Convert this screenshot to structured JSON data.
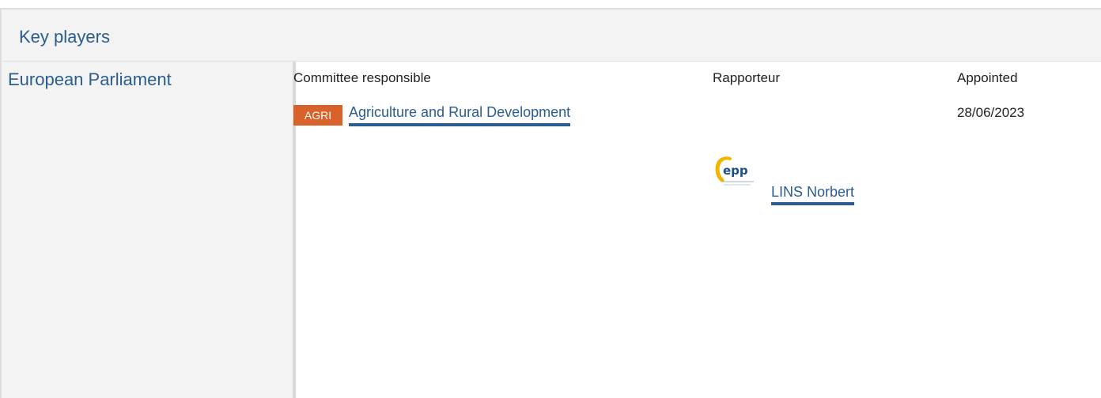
{
  "section": {
    "title": "Key players"
  },
  "institution": {
    "name": "European Parliament"
  },
  "columns": {
    "committee": "Committee responsible",
    "rapporteur": "Rapporteur",
    "appointed": "Appointed"
  },
  "committee": {
    "code": "AGRI",
    "name": "Agriculture and Rural Development",
    "badge_color": "#d9622b"
  },
  "appointment": {
    "date": "28/06/2023"
  },
  "rapporteur": {
    "party_logo": "epp-logo",
    "party_logo_text": "epp",
    "name": "LINS Norbert"
  },
  "colors": {
    "accent": "#2a5d8f",
    "panel_bg": "#f3f3f3"
  }
}
